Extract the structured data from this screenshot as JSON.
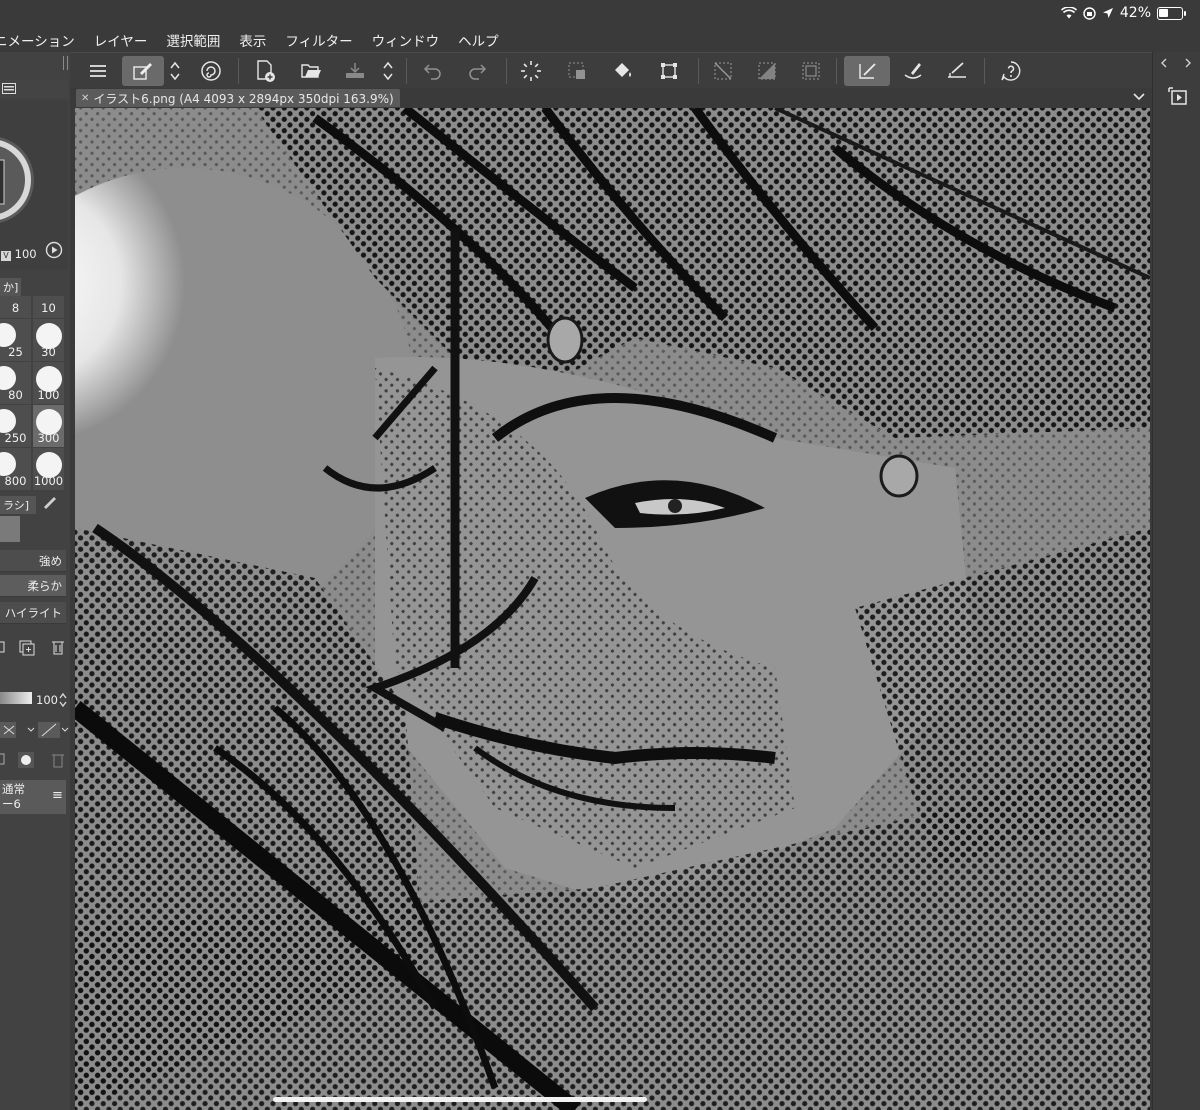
{
  "status": {
    "battery_text": "42%"
  },
  "menu": [
    "ニメーション",
    "レイヤー",
    "選択範囲",
    "表示",
    "フィルター",
    "ウィンドウ",
    "ヘルプ"
  ],
  "document": {
    "tab_title": "イラスト6.png (A4 4093 x 2894px 350dpi 163.9%)"
  },
  "left_panel": {
    "opacity_label": "100",
    "brush_set_label": "か]",
    "brush_sizes": [
      "8",
      "10",
      "25",
      "30",
      "80",
      "100",
      "250",
      "300",
      "800",
      "1000"
    ],
    "selected_brush_size": "300",
    "brush_tab_label": "ラシ]",
    "subtool_items": [
      "強め",
      "柔らか",
      "ハイライト"
    ],
    "selected_subtool": "柔らか",
    "layer_opacity": "100",
    "blend_mode": "通常",
    "layer_name": "ー6"
  },
  "icons": {
    "menu": "hamburger-icon",
    "subtool": "subtool-pen-icon",
    "stepper": "stepper-icon",
    "spiral": "spiral-icon",
    "new_doc": "new-document-icon",
    "open": "open-folder-icon",
    "save": "save-tray-icon",
    "undo": "undo-icon",
    "redo": "redo-icon",
    "loading": "spinner-icon",
    "select_clear": "selection-icon",
    "fill": "paint-bucket-icon",
    "transform": "transform-icon",
    "ruler1": "hide-selection-icon",
    "ruler2": "tone-icon",
    "ruler3": "border-icon",
    "pen_active": "pen-pressure-icon",
    "brush_stab": "brush-icon",
    "snap": "snap-ruler-icon",
    "help": "help-icon",
    "animation": "animation-icon"
  }
}
